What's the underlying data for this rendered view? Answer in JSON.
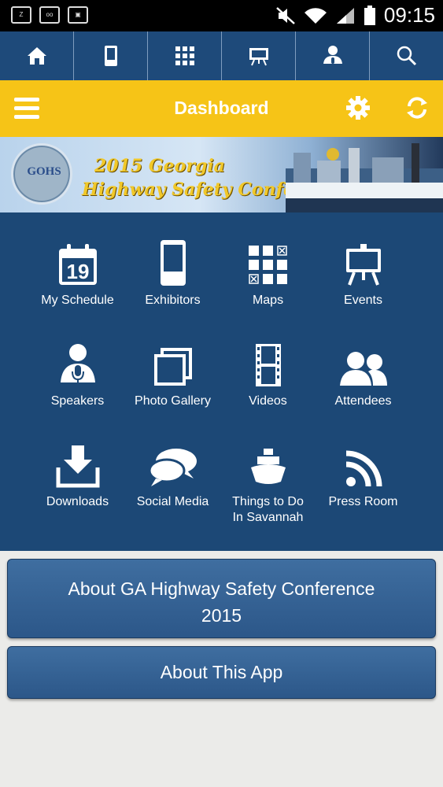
{
  "status_bar": {
    "time": "09:15",
    "left_icons": [
      "zone-icon",
      "voicemail-icon",
      "screen-icon"
    ]
  },
  "top_nav": [
    "home-icon",
    "exhibitors-icon",
    "maps-icon",
    "events-icon",
    "speakers-icon",
    "search-icon"
  ],
  "header": {
    "title": "Dashboard"
  },
  "banner": {
    "line1": "2015 Georgia",
    "line2": "Highway Safety Conference",
    "logo_text": "GOHS"
  },
  "grid": [
    {
      "label": "My Schedule",
      "icon": "calendar-icon",
      "day": "19"
    },
    {
      "label": "Exhibitors",
      "icon": "phone-icon"
    },
    {
      "label": "Maps",
      "icon": "maps-icon"
    },
    {
      "label": "Events",
      "icon": "easel-icon"
    },
    {
      "label": "Speakers",
      "icon": "speaker-icon"
    },
    {
      "label": "Photo Gallery",
      "icon": "photos-icon"
    },
    {
      "label": "Videos",
      "icon": "film-icon"
    },
    {
      "label": "Attendees",
      "icon": "attendees-icon"
    },
    {
      "label": "Downloads",
      "icon": "download-icon"
    },
    {
      "label": "Social Media",
      "icon": "chat-bubbles-icon"
    },
    {
      "label": "Things to Do In Savannah",
      "label_line1": "Things to Do",
      "label_line2": "In Savannah",
      "icon": "ship-icon"
    },
    {
      "label": "Press Room",
      "icon": "rss-icon"
    }
  ],
  "buttons": {
    "about_conference_line1": "About GA Highway Safety Conference",
    "about_conference_line2": "2015",
    "about_app": "About This App"
  },
  "colors": {
    "nav_blue": "#1e4a7a",
    "header_yellow": "#f6c417",
    "grid_blue": "#1c4876"
  }
}
